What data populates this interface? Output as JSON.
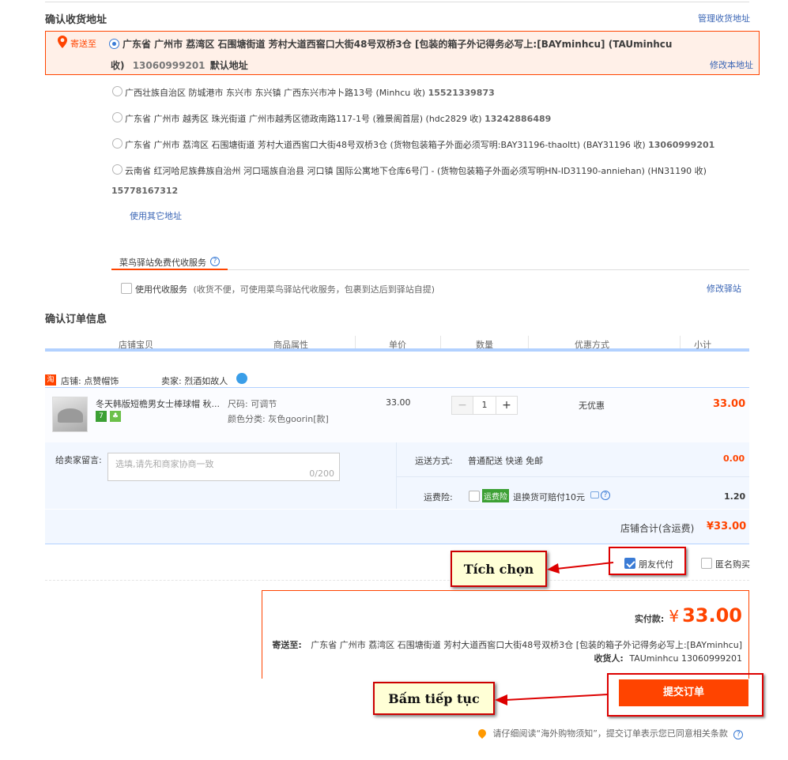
{
  "section_address": {
    "title": "确认收货地址",
    "manage_link": "管理收货地址",
    "send_to": "寄送至",
    "selected": {
      "line1": "广东省 广州市 荔湾区 石围塘街道 芳村大道西窖口大街48号双桥3仓 [包装的箱子外记得务必写上:[BAYminhcu]   (TAUminhcu",
      "line2_prefix": "收)",
      "phone": "13060999201",
      "default_tag": "默认地址",
      "modify_link": "修改本地址"
    },
    "options": [
      {
        "text": "广西壮族自治区 防城港市 东兴市 东兴镇 广西东兴市冲卜路13号  (Minhcu 收)",
        "phone": "15521339873"
      },
      {
        "text": "广东省 广州市 越秀区 珠光街道 广州市越秀区德政南路117-1号 (雅景阁首层)  (hdc2829 收)",
        "phone": "13242886489"
      },
      {
        "text": "广东省 广州市 荔湾区 石围塘街道 芳村大道西窖口大街48号双桥3仓 (货物包装箱子外面必须写明:BAY31196-thaoltt)  (BAY31196 收)",
        "phone": "13060999201"
      },
      {
        "text": "云南省 红河哈尼族彝族自治州 河口瑶族自治县 河口镇 国际公寓地下仓库6号门 - (货物包装箱子外面必须写明HN-ID31190-anniehan)  (HN31190 收)",
        "phone": "15778167312"
      }
    ],
    "use_other": "使用其它地址",
    "cainiao_tab": "菜鸟驿站免费代收服务",
    "use_service_label": "使用代收服务",
    "use_service_desc": "(收货不便，可使用菜鸟驿站代收服务，包裹到达后到驿站自提)",
    "modify_station": "修改驿站"
  },
  "section_order": {
    "title": "确认订单信息",
    "columns": [
      "店铺宝贝",
      "商品属性",
      "单价",
      "数量",
      "优惠方式",
      "小计"
    ],
    "shop_icon": "淘",
    "shop_label": "店铺: 点赞帽饰",
    "seller_label": "卖家: 烈酒如故人",
    "item": {
      "title": "冬天韩版短檐男女士棒球帽 秋...",
      "attr_size": "尺码: 可调节",
      "attr_color": "颜色分类: 灰色goorin[款]",
      "price": "33.00",
      "qty": "1",
      "qty_minus": "−",
      "qty_plus": "+",
      "discount": "无优惠",
      "subtotal": "33.00",
      "badge1": "7",
      "badge2": "♣"
    },
    "message_label": "给卖家留言:",
    "message_placeholder": "选填,请先和商家协商一致",
    "message_count": "0/200",
    "shipping_label": "运送方式:",
    "shipping_value": "普通配送 快递 免邮",
    "shipping_price": "0.00",
    "insurance_label": "运费险:",
    "insurance_badge": "运费险",
    "insurance_desc": "退换货可赔付10元",
    "insurance_price": "1.20",
    "shop_total_label": "店铺合计(含运费)",
    "shop_total": "¥33.00"
  },
  "options_bar": {
    "friend_pay": "朋友代付",
    "anonymous": "匿名购买"
  },
  "summary": {
    "paid_label": "实付款:",
    "currency": "¥",
    "amount": "33.00",
    "ship_to_label": "寄送至:",
    "ship_to": "广东省 广州市 荔湾区 石围塘街道 芳村大道西窖口大街48号双桥3仓 [包装的箱子外记得务必写上:[BAYminhcu]",
    "receiver_label": "收货人:",
    "receiver": "TAUminhcu 13060999201",
    "submit": "提交订单",
    "notice": "请仔细阅读“海外购物须知”，提交订单表示您已同意相关条款"
  },
  "annotations": {
    "check": "Tích chọn",
    "continue": "Bấm tiếp tục"
  },
  "colors": {
    "accent": "#ff4400",
    "link": "#3a65b5",
    "annotation_border": "#cc0000"
  }
}
